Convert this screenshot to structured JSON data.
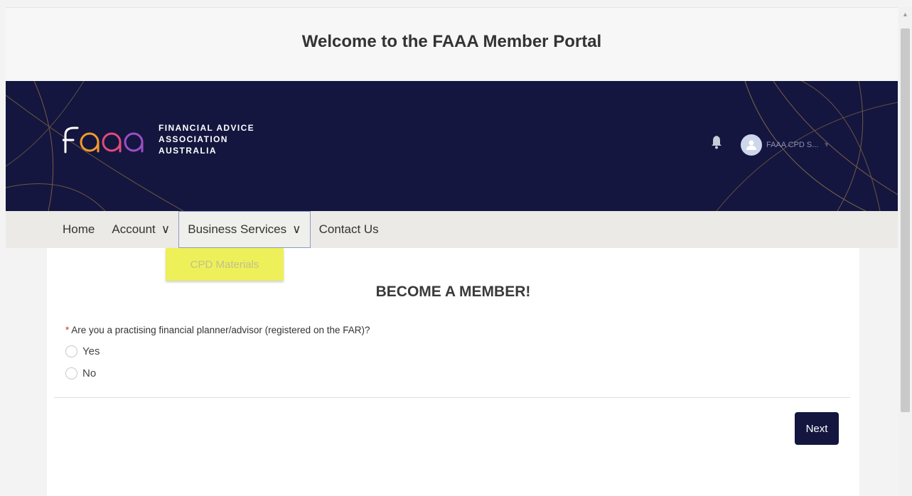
{
  "header": {
    "title": "Welcome to the FAAA Member Portal"
  },
  "brand": {
    "logo_letters": "faaa",
    "line1": "FINANCIAL ADVICE",
    "line2": "ASSOCIATION",
    "line3": "AUSTRALIA"
  },
  "user": {
    "name": "FAAA CPD S...",
    "caret": "▾",
    "avatar_icon": "user-icon",
    "notification_icon": "bell-icon"
  },
  "nav": {
    "items": [
      {
        "label": "Home"
      },
      {
        "label": "Account",
        "chevron": "∨"
      },
      {
        "label": "Business Services",
        "chevron": "∨"
      },
      {
        "label": "Contact Us"
      }
    ],
    "dropdown": {
      "items": [
        {
          "label": "CPD Materials"
        }
      ]
    }
  },
  "form": {
    "title": "BECOME A MEMBER!",
    "required_mark": "*",
    "question": "Are you a practising financial planner/advisor (registered on the FAR)?",
    "options": [
      {
        "label": "Yes"
      },
      {
        "label": "No"
      }
    ],
    "next_label": "Next"
  },
  "colors": {
    "banner": "#14163f",
    "highlight": "#eef059",
    "button": "#14163f",
    "required": "#c23934"
  }
}
